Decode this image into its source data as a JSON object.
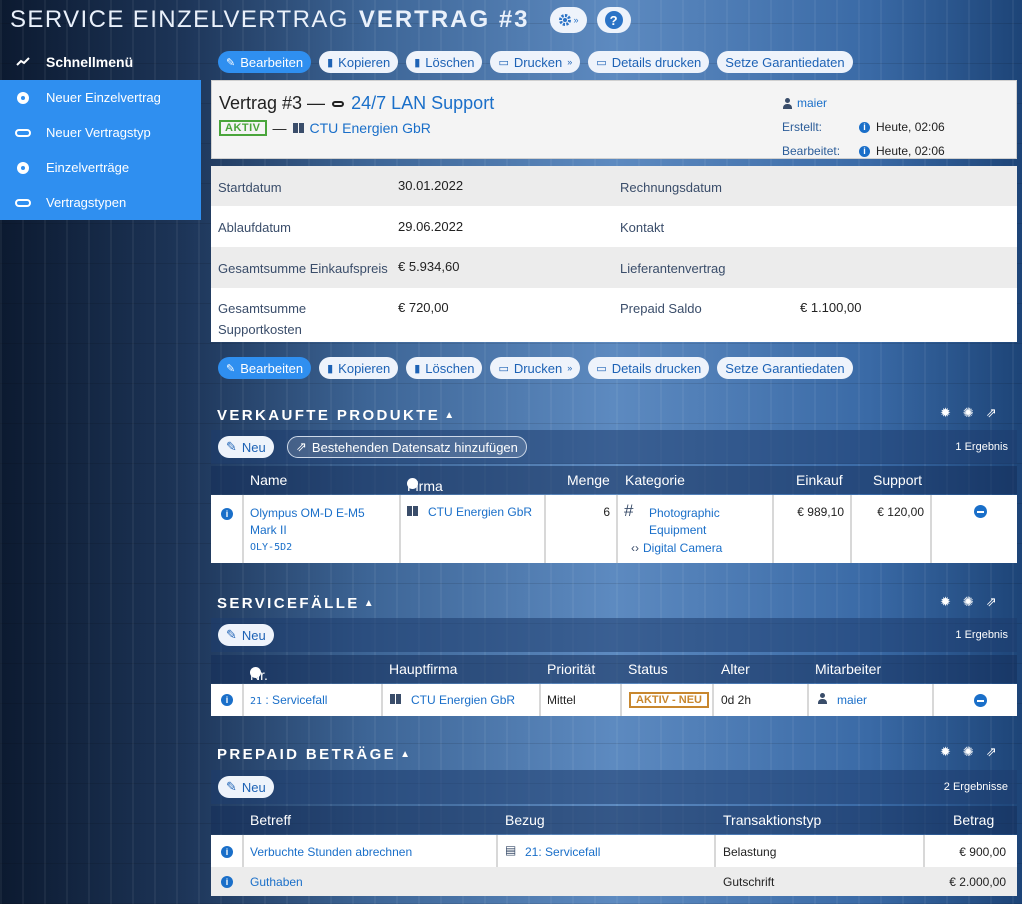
{
  "header": {
    "title_light": "SERVICE EINZELVERTRAG",
    "title_bold": "VERTRAG #3",
    "settings_icon": "gear-icon",
    "help_label": "?"
  },
  "sidebar": {
    "heading": "Schnellmenü",
    "items": [
      {
        "label": "Neuer Einzelvertrag",
        "icon": "ball-icon"
      },
      {
        "label": "Neuer Vertragstyp",
        "icon": "tag-icon"
      },
      {
        "label": "Einzelverträge",
        "icon": "ball-icon"
      },
      {
        "label": "Vertragstypen",
        "icon": "tag-icon"
      }
    ]
  },
  "toolbar": {
    "edit": "Bearbeiten",
    "copy": "Kopieren",
    "delete": "Löschen",
    "print": "Drucken",
    "print_details": "Details drucken",
    "warranty": "Setze Garantiedaten"
  },
  "contract": {
    "title_prefix": "Vertrag #3 —",
    "type": "24/7 LAN Support",
    "status": "AKTIV",
    "dash": "—",
    "company": "CTU Energien GbR",
    "user": "maier",
    "created_label": "Erstellt:",
    "created_value": "Heute, 02:06",
    "edited_label": "Bearbeitet:",
    "edited_value": "Heute, 02:06"
  },
  "details": {
    "startdatum_label": "Startdatum",
    "startdatum": "30.01.2022",
    "rechnungsdatum_label": "Rechnungsdatum",
    "ablaufdatum_label": "Ablaufdatum",
    "ablaufdatum": "29.06.2022",
    "kontakt_label": "Kontakt",
    "einkauf_label": "Gesamtsumme Einkaufspreis",
    "einkauf": "€ 5.934,60",
    "lieferant_label": "Lieferantenvertrag",
    "support_label_1": "Gesamtsumme",
    "support_label_2": "Supportkosten",
    "support": "€ 720,00",
    "prepaid_label": "Prepaid Saldo",
    "prepaid": "€ 1.100,00"
  },
  "products": {
    "title": "VERKAUFTE PRODUKTE",
    "new_label": "Neu",
    "add_existing_label": "Bestehenden Datensatz hinzufügen",
    "count": "1 Ergebnis",
    "columns": {
      "name": "Name",
      "firma": "Firma",
      "menge": "Menge",
      "kategorie": "Kategorie",
      "einkauf": "Einkauf",
      "support": "Support"
    },
    "rows": [
      {
        "name_1": "Olympus OM-D E-M5",
        "name_2": "Mark II",
        "code": "OLY-5D2",
        "firma": "CTU Energien GbR",
        "menge": "6",
        "kategorie_1": "Photographic",
        "kategorie_2": "Equipment",
        "sub": "Digital Camera",
        "einkauf": "€ 989,10",
        "support": "€ 120,00"
      }
    ]
  },
  "cases": {
    "title": "SERVICEFÄLLE",
    "new_label": "Neu",
    "count": "1 Ergebnis",
    "columns": {
      "nr": "Nr.",
      "hauptfirma": "Hauptfirma",
      "prioritaet": "Priorität",
      "status": "Status",
      "alter": "Alter",
      "mitarbeiter": "Mitarbeiter"
    },
    "rows": [
      {
        "nr": "21",
        "name": ": Servicefall",
        "hauptfirma": "CTU Energien GbR",
        "prioritaet": "Mittel",
        "status": "AKTIV - NEU",
        "alter": "0d 2h",
        "mitarbeiter": "maier"
      }
    ]
  },
  "prepaid": {
    "title": "PREPAID BETRÄGE",
    "new_label": "Neu",
    "count": "2 Ergebnisse",
    "columns": {
      "betreff": "Betreff",
      "bezug": "Bezug",
      "typ": "Transaktionstyp",
      "betrag": "Betrag"
    },
    "rows": [
      {
        "betreff": "Verbuchte Stunden abrechnen",
        "bezug": "21: Servicefall",
        "typ": "Belastung",
        "betrag": "€ 900,00"
      },
      {
        "betreff": "Guthaben",
        "bezug": "",
        "typ": "Gutschrift",
        "betrag": "€ 2.000,00"
      }
    ]
  },
  "colors": {
    "accent": "#2f8ff0",
    "link": "#1a6fc9",
    "active": "#4aa53b",
    "status_new": "#c8872e"
  }
}
